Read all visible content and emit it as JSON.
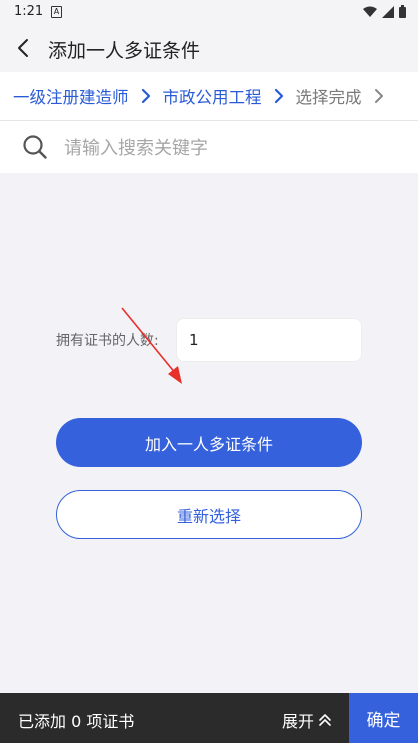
{
  "status_bar": {
    "time": "1:21",
    "notification_icon": "A"
  },
  "header": {
    "title": "添加一人多证条件",
    "back_icon": "chevron-left-icon"
  },
  "breadcrumb": {
    "items": [
      {
        "label": "一级注册建造师"
      },
      {
        "label": "市政公用工程"
      },
      {
        "label": "选择完成"
      }
    ]
  },
  "search": {
    "placeholder": "请输入搜索关键字",
    "value": ""
  },
  "form": {
    "count_label": "拥有证书的人数:",
    "count_value": "1"
  },
  "buttons": {
    "add_condition": "加入一人多证条件",
    "reselect": "重新选择"
  },
  "bottom_bar": {
    "added_text": "已添加 0 项证书",
    "expand_label": "展开",
    "confirm_label": "确定"
  },
  "colors": {
    "accent": "#3561dc",
    "breadcrumb_active": "#2a5bd7",
    "annotation_arrow": "#e8302a",
    "bottom_bar": "#2b2b2b"
  }
}
